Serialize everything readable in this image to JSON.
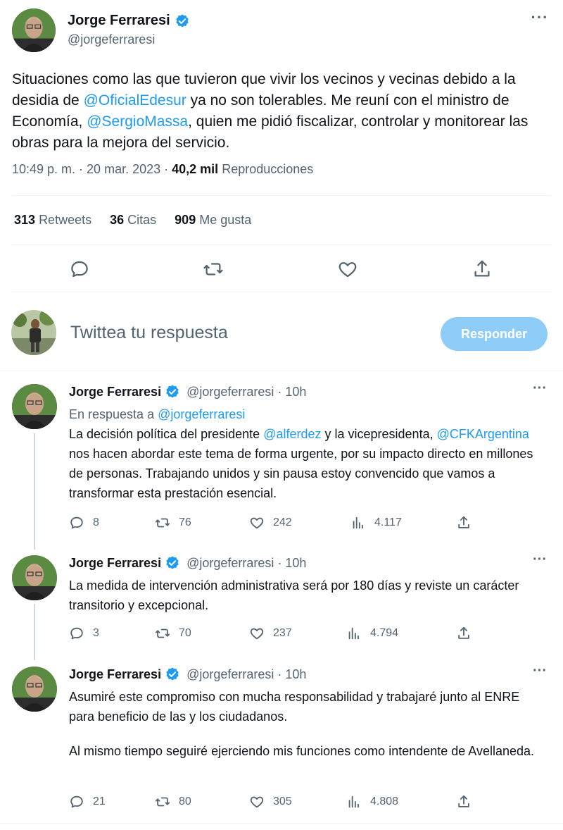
{
  "main_tweet": {
    "author_name": "Jorge Ferraresi",
    "author_handle": "@jorgeferraresi",
    "text_parts": {
      "p1": "Situaciones como las que tuvieron que vivir los vecinos y vecinas debido a la desidia de ",
      "m1": "@OficialEdesur",
      "p2": " ya no son tolerables. Me reuní con el ministro de Economía, ",
      "m2": "@SergioMassa",
      "p3": ", quien me pidió fiscalizar, controlar y monitorear las obras para la mejora del servicio."
    },
    "time": "10:49 p. m. · 20 mar. 2023 ·",
    "views_count": "40,2 mil",
    "views_label": "Reproducciones",
    "stats": {
      "retweets_count": "313",
      "retweets_label": "Retweets",
      "quotes_count": "36",
      "quotes_label": "Citas",
      "likes_count": "909",
      "likes_label": "Me gusta"
    },
    "more_icon": "more-options-icon"
  },
  "composer": {
    "placeholder": "Twittea tu respuesta",
    "button_label": "Responder"
  },
  "replies": [
    {
      "name": "Jorge Ferraresi",
      "handle": "@jorgeferraresi · 10h",
      "in_reply_prefix": "En respuesta a ",
      "in_reply_handle": "@jorgeferraresi",
      "text_parts": {
        "p1": "La decisión política del presidente ",
        "m1": "@alferdez",
        "p2": " y la vicepresidenta, ",
        "m2": "@CFKArgentina",
        "p3": " nos hacen abordar este tema de forma urgente, por su impacto directo en millones de personas. Trabajando unidos y sin pausa estoy convencido que vamos a transformar esta prestación esencial."
      },
      "replies": "8",
      "retweets": "76",
      "likes": "242",
      "views": "4.117"
    },
    {
      "name": "Jorge Ferraresi",
      "handle": "@jorgeferraresi · 10h",
      "text": "La medida de intervención administrativa será por 180 días y reviste un carácter transitorio y excepcional.",
      "replies": "3",
      "retweets": "70",
      "likes": "237",
      "views": "4.794"
    },
    {
      "name": "Jorge Ferraresi",
      "handle": "@jorgeferraresi · 10h",
      "text_a": "Asumiré este compromiso con mucha responsabilidad y trabajaré junto al ENRE para beneficio de las y los ciudadanos.",
      "text_b": "Al mismo tiempo seguiré ejerciendo mis funciones como intendente de Avellaneda.",
      "replies": "21",
      "retweets": "80",
      "likes": "305",
      "views": "4.808"
    }
  ],
  "colors": {
    "link": "#1d9bf0",
    "muted": "#536471",
    "reply_button": "#8ecdf8"
  }
}
